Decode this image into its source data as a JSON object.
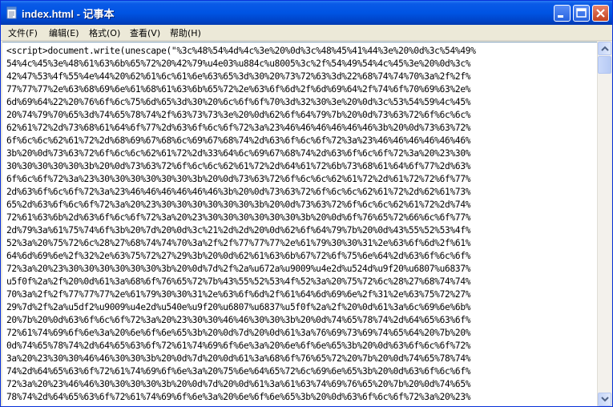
{
  "window": {
    "title": "index.html - 记事本"
  },
  "menu": [
    {
      "label": "文件(F)"
    },
    {
      "label": "编辑(E)"
    },
    {
      "label": "格式(O)"
    },
    {
      "label": "查看(V)"
    },
    {
      "label": "帮助(H)"
    }
  ],
  "editor": {
    "lines": [
      "<script>document.write(unescape(\"%3c%48%54%4d%4c%3e%20%0d%3c%48%45%41%44%3e%20%0d%3c%54%49%",
      "54%4c%45%3e%48%61%63%6b%65%72%20%42%79%u4e03%u884c%u8005%3c%2f%54%49%54%4c%45%3e%20%0d%3c%",
      "42%47%53%4f%55%4e%44%20%62%61%6c%61%6e%63%65%3d%30%20%73%72%63%3d%22%68%74%74%70%3a%2f%2f%",
      "77%77%77%2e%63%68%69%6e%61%68%61%63%6b%65%72%2e%63%6f%6d%2f%6d%69%64%2f%74%6f%70%69%63%2e%",
      "6d%69%64%22%20%76%6f%6c%75%6d%65%3d%30%20%6c%6f%6f%70%3d%32%30%3e%20%0d%3c%53%54%59%4c%45%",
      "20%74%79%70%65%3d%74%65%78%74%2f%63%73%73%3e%20%0d%62%6f%64%79%7b%20%0d%73%63%72%6f%6c%6c%",
      "62%61%72%2d%73%68%61%64%6f%77%2d%63%6f%6c%6f%72%3a%23%46%46%46%46%46%46%3b%20%0d%73%63%72%",
      "6f%6c%6c%62%61%72%2d%68%69%67%68%6c%69%67%68%74%2d%63%6f%6c%6f%72%3a%23%46%46%46%46%46%46%",
      "3b%20%0d%73%63%72%6f%6c%6c%62%61%72%2d%33%64%6c%69%67%68%74%2d%63%6f%6c%6f%72%3a%20%23%30%",
      "30%30%30%30%30%3b%20%0d%73%63%72%6f%6c%6c%62%61%72%2d%64%61%72%6b%73%68%61%64%6f%77%2d%63%",
      "6f%6c%6f%72%3a%23%30%30%30%30%30%30%3b%20%0d%73%63%72%6f%6c%6c%62%61%72%2d%61%72%72%6f%77%",
      "2d%63%6f%6c%6f%72%3a%23%46%46%46%46%46%46%3b%20%0d%73%63%72%6f%6c%6c%62%61%72%2d%62%61%73%",
      "65%2d%63%6f%6c%6f%72%3a%20%23%30%30%30%30%30%30%3b%20%0d%73%63%72%6f%6c%6c%62%61%72%2d%74%",
      "72%61%63%6b%2d%63%6f%6c%6f%72%3a%20%23%30%30%30%30%30%30%3b%20%0d%6f%76%65%72%66%6c%6f%77%",
      "2d%79%3a%61%75%74%6f%3b%20%7d%20%0d%3c%21%2d%2d%20%0d%62%6f%64%79%7b%20%0d%43%55%52%53%4f%",
      "52%3a%20%75%72%6c%28%27%68%74%74%70%3a%2f%2f%77%77%77%2e%61%79%30%30%31%2e%63%6f%6d%2f%61%",
      "64%6d%69%6e%2f%32%2e%63%75%72%27%29%3b%20%0d%62%61%63%6b%67%72%6f%75%6e%64%2d%63%6f%6c%6f%",
      "72%3a%20%23%30%30%30%30%30%30%3b%20%0d%7d%2f%2a%u672a%u9009%u4e2d%u524d%u9f20%u6807%u6837%",
      "u5f0f%2a%2f%20%0d%61%3a%68%6f%76%65%72%7b%43%55%52%53%4f%52%3a%20%75%72%6c%28%27%68%74%74%",
      "70%3a%2f%2f%77%77%77%2e%61%79%30%30%31%2e%63%6f%6d%2f%61%64%6d%69%6e%2f%31%2e%63%75%72%27%",
      "29%7d%2f%2a%u5df2%u9009%u4e2d%u540e%u9f20%u6807%u6837%u5f0f%2a%2f%20%0d%61%3a%6c%69%6e%6b%",
      "20%7b%20%0d%63%6f%6c%6f%72%3a%20%23%30%30%46%46%30%30%3b%20%0d%74%65%78%74%2d%64%65%63%6f%",
      "72%61%74%69%6f%6e%3a%20%6e%6f%6e%65%3b%20%0d%7d%20%0d%61%3a%76%69%73%69%74%65%64%20%7b%20%",
      "0d%74%65%78%74%2d%64%65%63%6f%72%61%74%69%6f%6e%3a%20%6e%6f%6e%65%3b%20%0d%63%6f%6c%6f%72%",
      "3a%20%23%30%30%46%46%30%30%3b%20%0d%7d%20%0d%61%3a%68%6f%76%65%72%20%7b%20%0d%74%65%78%74%",
      "74%2d%64%65%63%6f%72%61%74%69%6f%6e%3a%20%75%6e%64%65%72%6c%69%6e%65%3b%20%0d%63%6f%6c%6f%",
      "72%3a%20%23%46%46%30%30%30%30%3b%20%0d%7d%20%0d%61%3a%61%63%74%69%76%65%20%7b%20%0d%74%65%",
      "78%74%2d%64%65%63%6f%72%61%74%69%6f%6e%3a%20%6e%6f%6e%65%3b%20%0d%63%6f%6c%6f%72%3a%20%23%"
    ]
  }
}
